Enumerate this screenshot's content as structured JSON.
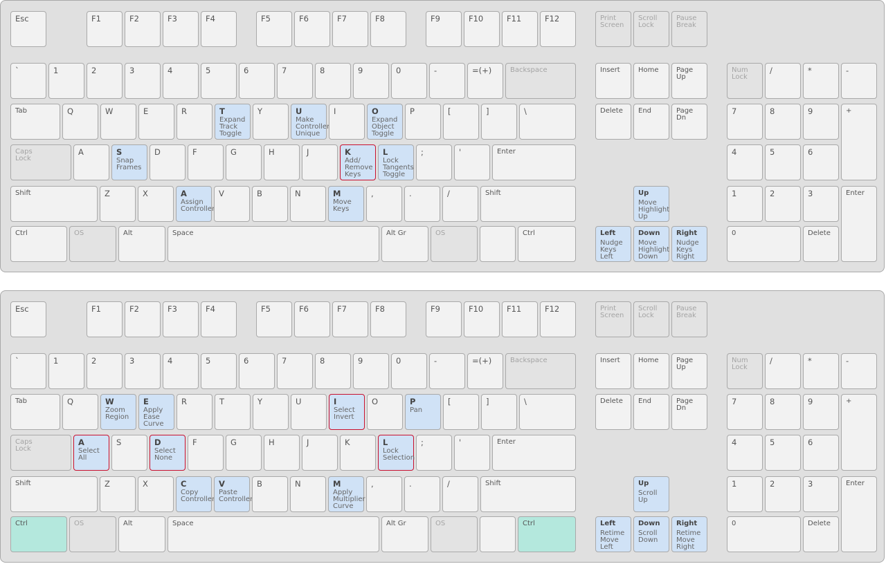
{
  "colors": {
    "board_bg": "#e0e0e0",
    "key_bg": "#f2f2f2",
    "key_disabled_bg": "#e3e3e3",
    "key_highlight_bg": "#d0e2f6",
    "key_selected_border": "#c8102e",
    "key_modifier_bg": "#b4e8dd"
  },
  "keyboards": [
    {
      "name": "keyboard-1",
      "keys": {
        "esc": {
          "cap": "Esc"
        },
        "f1": {
          "cap": "F1"
        },
        "f2": {
          "cap": "F2"
        },
        "f3": {
          "cap": "F3"
        },
        "f4": {
          "cap": "F4"
        },
        "f5": {
          "cap": "F5"
        },
        "f6": {
          "cap": "F6"
        },
        "f7": {
          "cap": "F7"
        },
        "f8": {
          "cap": "F8"
        },
        "f9": {
          "cap": "F9"
        },
        "f10": {
          "cap": "F10"
        },
        "f11": {
          "cap": "F11"
        },
        "f12": {
          "cap": "F12"
        },
        "printscreen": {
          "cap": "Print\nScreen"
        },
        "scrolllock": {
          "cap": "Scroll\nLock"
        },
        "pause": {
          "cap": "Pause\nBreak"
        },
        "backtick": {
          "cap": "`"
        },
        "n1": {
          "cap": "1"
        },
        "n2": {
          "cap": "2"
        },
        "n3": {
          "cap": "3"
        },
        "n4": {
          "cap": "4"
        },
        "n5": {
          "cap": "5"
        },
        "n6": {
          "cap": "6"
        },
        "n7": {
          "cap": "7"
        },
        "n8": {
          "cap": "8"
        },
        "n9": {
          "cap": "9"
        },
        "n0": {
          "cap": "0"
        },
        "minus": {
          "cap": "-"
        },
        "equals": {
          "cap": "=(+)"
        },
        "backspace": {
          "cap": "Backspace"
        },
        "insert": {
          "cap": "Insert"
        },
        "home": {
          "cap": "Home"
        },
        "pageup": {
          "cap": "Page Up"
        },
        "numlock": {
          "cap": "Num\nLock"
        },
        "kp_divide": {
          "cap": "/"
        },
        "kp_multiply": {
          "cap": "*"
        },
        "kp_minus": {
          "cap": "-"
        },
        "tab": {
          "cap": "Tab"
        },
        "q": {
          "cap": "Q"
        },
        "w": {
          "cap": "W"
        },
        "e": {
          "cap": "E"
        },
        "r": {
          "cap": "R"
        },
        "t": {
          "cap": "T",
          "desc": "Expand\nTrack\nToggle"
        },
        "y": {
          "cap": "Y"
        },
        "u": {
          "cap": "U",
          "desc": "Make\nController\nUnique"
        },
        "i": {
          "cap": "I"
        },
        "o": {
          "cap": "O",
          "desc": "Expand\nObject\nToggle"
        },
        "p": {
          "cap": "P"
        },
        "lbracket": {
          "cap": "["
        },
        "rbracket": {
          "cap": "]"
        },
        "backslash": {
          "cap": "\\"
        },
        "delete": {
          "cap": "Delete"
        },
        "end": {
          "cap": "End"
        },
        "pagedown": {
          "cap": "Page Dn"
        },
        "kp7": {
          "cap": "7"
        },
        "kp8": {
          "cap": "8"
        },
        "kp9": {
          "cap": "9"
        },
        "kp_plus": {
          "cap": "+"
        },
        "capslock": {
          "cap": "Caps\nLock"
        },
        "a": {
          "cap": "A"
        },
        "s": {
          "cap": "S",
          "desc": "Snap\nFrames"
        },
        "d": {
          "cap": "D"
        },
        "f": {
          "cap": "F"
        },
        "g": {
          "cap": "G"
        },
        "h": {
          "cap": "H"
        },
        "j": {
          "cap": "J"
        },
        "k": {
          "cap": "K",
          "desc": "Add/\nRemove\nKeys"
        },
        "l": {
          "cap": "L",
          "desc": "Lock\nTangents\nToggle"
        },
        "semicolon": {
          "cap": ";"
        },
        "quote": {
          "cap": "'"
        },
        "enter": {
          "cap": "Enter"
        },
        "kp4": {
          "cap": "4"
        },
        "kp5": {
          "cap": "5"
        },
        "kp6": {
          "cap": "6"
        },
        "lshift": {
          "cap": "Shift"
        },
        "z": {
          "cap": "Z"
        },
        "x": {
          "cap": "X"
        },
        "c": {
          "cap": "A",
          "desc": "Assign\nController"
        },
        "v": {
          "cap": "V"
        },
        "b": {
          "cap": "B"
        },
        "n": {
          "cap": "N"
        },
        "m": {
          "cap": "M",
          "desc": "Move\nKeys"
        },
        "comma": {
          "cap": ","
        },
        "period": {
          "cap": "."
        },
        "slash": {
          "cap": "/"
        },
        "rshift": {
          "cap": "Shift"
        },
        "up": {
          "cap": "Up",
          "desc": "Move\nHighlight\nUp"
        },
        "kp1": {
          "cap": "1"
        },
        "kp2": {
          "cap": "2"
        },
        "kp3": {
          "cap": "3"
        },
        "kp_enter": {
          "cap": "Enter"
        },
        "lctrl": {
          "cap": "Ctrl"
        },
        "los": {
          "cap": "OS"
        },
        "lalt": {
          "cap": "Alt"
        },
        "space": {
          "cap": "Space"
        },
        "altgr": {
          "cap": "Alt Gr"
        },
        "ros": {
          "cap": "OS"
        },
        "menu": {
          "cap": ""
        },
        "rctrl": {
          "cap": "Ctrl"
        },
        "left": {
          "cap": "Left",
          "desc": "Nudge\nKeys Left"
        },
        "down": {
          "cap": "Down",
          "desc": "Move\nHighlight\nDown"
        },
        "right": {
          "cap": "Right",
          "desc": "Nudge\nKeys Right"
        },
        "kp0": {
          "cap": "0"
        },
        "kp_delete": {
          "cap": "Delete"
        }
      }
    },
    {
      "name": "keyboard-2",
      "keys": {
        "esc": {
          "cap": "Esc"
        },
        "f1": {
          "cap": "F1"
        },
        "f2": {
          "cap": "F2"
        },
        "f3": {
          "cap": "F3"
        },
        "f4": {
          "cap": "F4"
        },
        "f5": {
          "cap": "F5"
        },
        "f6": {
          "cap": "F6"
        },
        "f7": {
          "cap": "F7"
        },
        "f8": {
          "cap": "F8"
        },
        "f9": {
          "cap": "F9"
        },
        "f10": {
          "cap": "F10"
        },
        "f11": {
          "cap": "F11"
        },
        "f12": {
          "cap": "F12"
        },
        "printscreen": {
          "cap": "Print\nScreen"
        },
        "scrolllock": {
          "cap": "Scroll\nLock"
        },
        "pause": {
          "cap": "Pause\nBreak"
        },
        "backtick": {
          "cap": "`"
        },
        "n1": {
          "cap": "1"
        },
        "n2": {
          "cap": "2"
        },
        "n3": {
          "cap": "3"
        },
        "n4": {
          "cap": "4"
        },
        "n5": {
          "cap": "5"
        },
        "n6": {
          "cap": "6"
        },
        "n7": {
          "cap": "7"
        },
        "n8": {
          "cap": "8"
        },
        "n9": {
          "cap": "9"
        },
        "n0": {
          "cap": "0"
        },
        "minus": {
          "cap": "-"
        },
        "equals": {
          "cap": "=(+)"
        },
        "backspace": {
          "cap": "Backspace"
        },
        "insert": {
          "cap": "Insert"
        },
        "home": {
          "cap": "Home"
        },
        "pageup": {
          "cap": "Page Up"
        },
        "numlock": {
          "cap": "Num\nLock"
        },
        "kp_divide": {
          "cap": "/"
        },
        "kp_multiply": {
          "cap": "*"
        },
        "kp_minus": {
          "cap": "-"
        },
        "tab": {
          "cap": "Tab"
        },
        "q": {
          "cap": "Q"
        },
        "w": {
          "cap": "W",
          "desc": "Zoom\nRegion"
        },
        "e": {
          "cap": "E",
          "desc": "Apply Ease\nCurve"
        },
        "r": {
          "cap": "R"
        },
        "t": {
          "cap": "T"
        },
        "y": {
          "cap": "Y"
        },
        "u": {
          "cap": "U"
        },
        "i": {
          "cap": "I",
          "desc": "Select\nInvert"
        },
        "o": {
          "cap": "O"
        },
        "p": {
          "cap": "P",
          "desc": "Pan"
        },
        "lbracket": {
          "cap": "["
        },
        "rbracket": {
          "cap": "]"
        },
        "backslash": {
          "cap": "\\"
        },
        "delete": {
          "cap": "Delete"
        },
        "end": {
          "cap": "End"
        },
        "pagedown": {
          "cap": "Page Dn"
        },
        "kp7": {
          "cap": "7"
        },
        "kp8": {
          "cap": "8"
        },
        "kp9": {
          "cap": "9"
        },
        "kp_plus": {
          "cap": "+"
        },
        "capslock": {
          "cap": "Caps\nLock"
        },
        "a": {
          "cap": "A",
          "desc": "Select\nAll"
        },
        "s": {
          "cap": "S"
        },
        "d": {
          "cap": "D",
          "desc": "Select\nNone"
        },
        "f": {
          "cap": "F"
        },
        "g": {
          "cap": "G"
        },
        "h": {
          "cap": "H"
        },
        "j": {
          "cap": "J"
        },
        "k": {
          "cap": "K"
        },
        "l": {
          "cap": "L",
          "desc": "Lock\nSelection"
        },
        "semicolon": {
          "cap": ";"
        },
        "quote": {
          "cap": "'"
        },
        "enter": {
          "cap": "Enter"
        },
        "kp4": {
          "cap": "4"
        },
        "kp5": {
          "cap": "5"
        },
        "kp6": {
          "cap": "6"
        },
        "lshift": {
          "cap": "Shift"
        },
        "z": {
          "cap": "Z"
        },
        "x": {
          "cap": "X"
        },
        "c": {
          "cap": "C",
          "desc": "Copy\nController"
        },
        "v": {
          "cap": "V",
          "desc": "Paste\nController"
        },
        "b": {
          "cap": "B"
        },
        "n": {
          "cap": "N"
        },
        "m": {
          "cap": "M",
          "desc": "Apply\nMultiplier\nCurve"
        },
        "comma": {
          "cap": ","
        },
        "period": {
          "cap": "."
        },
        "slash": {
          "cap": "/"
        },
        "rshift": {
          "cap": "Shift"
        },
        "up": {
          "cap": "Up",
          "desc": "Scroll\nUp"
        },
        "kp1": {
          "cap": "1"
        },
        "kp2": {
          "cap": "2"
        },
        "kp3": {
          "cap": "3"
        },
        "kp_enter": {
          "cap": "Enter"
        },
        "lctrl": {
          "cap": "Ctrl"
        },
        "los": {
          "cap": "OS"
        },
        "lalt": {
          "cap": "Alt"
        },
        "space": {
          "cap": "Space"
        },
        "altgr": {
          "cap": "Alt Gr"
        },
        "ros": {
          "cap": "OS"
        },
        "menu": {
          "cap": ""
        },
        "rctrl": {
          "cap": "Ctrl"
        },
        "left": {
          "cap": "Left",
          "desc": "Retime\nMove Left"
        },
        "down": {
          "cap": "Down",
          "desc": "Scroll\nDown"
        },
        "right": {
          "cap": "Right",
          "desc": "Retime\nMove Right"
        },
        "kp0": {
          "cap": "0"
        },
        "kp_delete": {
          "cap": "Delete"
        }
      },
      "states": {
        "highlighted": [
          "w",
          "e",
          "i",
          "p",
          "a",
          "d",
          "l",
          "c",
          "v",
          "m",
          "up",
          "left",
          "down",
          "right"
        ],
        "selected": [
          "i",
          "a",
          "d",
          "l"
        ],
        "modifier_active": [
          "lctrl",
          "rctrl"
        ]
      }
    }
  ],
  "keyboard_1_states": {
    "highlighted": [
      "t",
      "u",
      "o",
      "s",
      "k",
      "l",
      "c",
      "m",
      "up",
      "left",
      "down",
      "right"
    ],
    "selected": [
      "k"
    ],
    "modifier_active": []
  }
}
